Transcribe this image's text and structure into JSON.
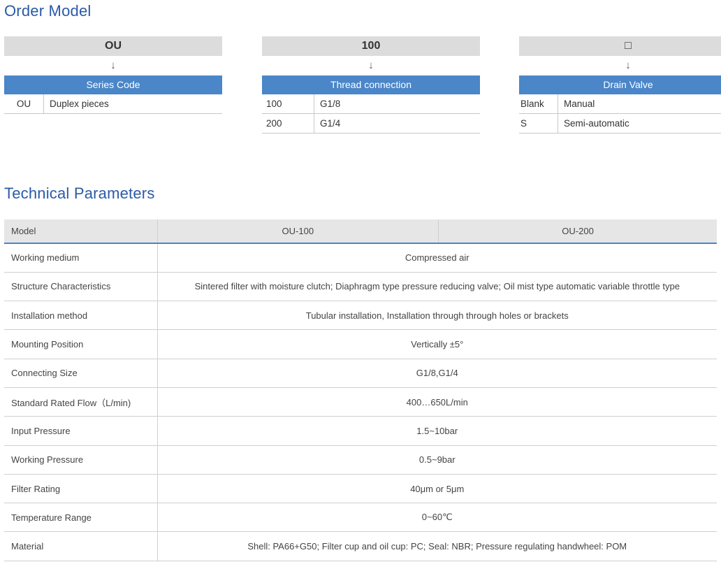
{
  "order_model": {
    "title": "Order Model",
    "arrow": "↓",
    "columns": [
      {
        "code": "OU",
        "header": "Series Code",
        "rows": [
          {
            "key": "OU",
            "value": "Duplex pieces"
          }
        ]
      },
      {
        "code": "100",
        "header": "Thread connection",
        "rows": [
          {
            "key": "100",
            "value": "G1/8"
          },
          {
            "key": "200",
            "value": "G1/4"
          }
        ]
      },
      {
        "code": "□",
        "header": "Drain Valve",
        "rows": [
          {
            "key": "Blank",
            "value": "Manual"
          },
          {
            "key": "S",
            "value": "Semi-automatic"
          }
        ]
      }
    ]
  },
  "technical_parameters": {
    "title": "Technical Parameters",
    "header": {
      "label": "Model",
      "col1": "OU-100",
      "col2": "OU-200"
    },
    "rows": [
      {
        "label": "Working medium",
        "value": "Compressed air"
      },
      {
        "label": "Structure Characteristics",
        "value": "Sintered filter with moisture clutch; Diaphragm type pressure reducing valve; Oil mist type automatic variable throttle type"
      },
      {
        "label": "Installation method",
        "value": "Tubular installation, Installation through through holes or brackets"
      },
      {
        "label": "Mounting Position",
        "value": "Vertically ±5°"
      },
      {
        "label": "Connecting Size",
        "value": "G1/8,G1/4"
      },
      {
        "label": "Standard Rated Flow（L/min)",
        "value": "400…650L/min"
      },
      {
        "label": "Input Pressure",
        "value": "1.5~10bar"
      },
      {
        "label": "Working Pressure",
        "value": "0.5~9bar"
      },
      {
        "label": "Filter Rating",
        "value": "40μm or 5μm"
      },
      {
        "label": "Temperature Range",
        "value": "0~60℃"
      },
      {
        "label": "Material",
        "value": "Shell: PA66+G50; Filter cup and oil cup: PC; Seal: NBR; Pressure regulating handwheel: POM"
      }
    ]
  },
  "colors": {
    "title": "#2a5aa8",
    "header_blue": "#4a86c8",
    "code_gray": "#dcdcdc"
  }
}
